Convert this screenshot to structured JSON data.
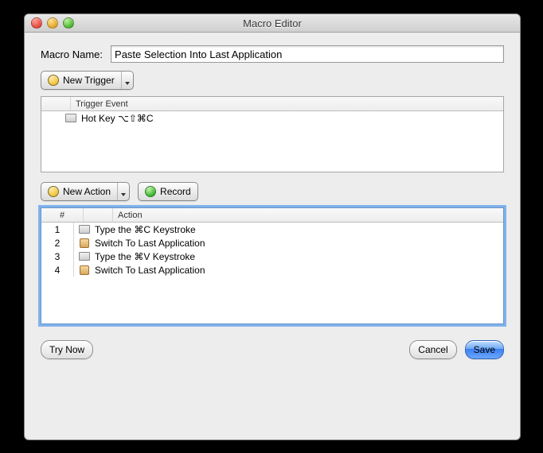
{
  "window": {
    "title": "Macro Editor"
  },
  "form": {
    "name_label": "Macro Name:",
    "name_value": "Paste Selection Into Last Application"
  },
  "buttons": {
    "new_trigger": "New Trigger",
    "new_action": "New Action",
    "record": "Record",
    "try_now": "Try Now",
    "cancel": "Cancel",
    "save": "Save"
  },
  "triggers": {
    "header": "Trigger Event",
    "rows": [
      {
        "icon": "keyboard",
        "label": "Hot Key ⌥⇧⌘C"
      }
    ]
  },
  "actions": {
    "headers": {
      "num": "#",
      "action": "Action"
    },
    "rows": [
      {
        "n": "1",
        "icon": "keyboard",
        "label": "Type the ⌘C Keystroke"
      },
      {
        "n": "2",
        "icon": "app",
        "label": "Switch To Last Application"
      },
      {
        "n": "3",
        "icon": "keyboard",
        "label": "Type the ⌘V Keystroke"
      },
      {
        "n": "4",
        "icon": "app",
        "label": "Switch To Last Application"
      }
    ]
  }
}
